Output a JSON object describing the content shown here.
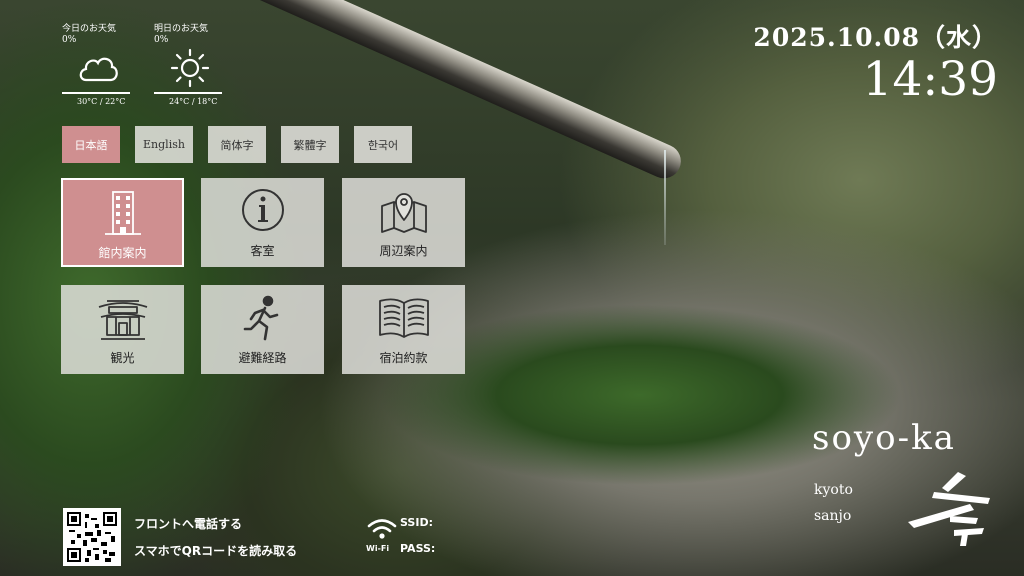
{
  "weather": {
    "today": {
      "label": "今日のお天気",
      "precip": "0%",
      "icon": "cloud-icon",
      "temp": "30°C / 22°C"
    },
    "tomorrow": {
      "label": "明日のお天気",
      "precip": "0%",
      "icon": "sun-icon",
      "temp": "24°C / 18°C"
    }
  },
  "clock": {
    "date": "2025.10.08（水）",
    "time": "14:39"
  },
  "languages": [
    {
      "label": "日本語",
      "active": true
    },
    {
      "label": "English",
      "active": false
    },
    {
      "label": "简体字",
      "active": false
    },
    {
      "label": "繁體字",
      "active": false
    },
    {
      "label": "한국어",
      "active": false
    }
  ],
  "menu": [
    {
      "label": "館内案内",
      "icon": "building-icon",
      "active": true
    },
    {
      "label": "客室",
      "icon": "info-icon",
      "active": false
    },
    {
      "label": "周辺案内",
      "icon": "map-icon",
      "active": false
    },
    {
      "label": "観光",
      "icon": "temple-icon",
      "active": false
    },
    {
      "label": "避難経路",
      "icon": "running-person-icon",
      "active": false
    },
    {
      "label": "宿泊約款",
      "icon": "book-icon",
      "active": false
    }
  ],
  "brand": {
    "name": "soyo-ka",
    "city_line1": "kyoto",
    "city_line2": "sanjo"
  },
  "footer": {
    "front_line1": "フロントへ電話する",
    "front_line2": "スマホでQRコードを読み取る",
    "wifi_word": "Wi-Fi",
    "ssid_label": "SSID:",
    "pass_label": "PASS:"
  },
  "colors": {
    "accent": "#cf8f90",
    "tile_bg": "#e1e1dc"
  }
}
